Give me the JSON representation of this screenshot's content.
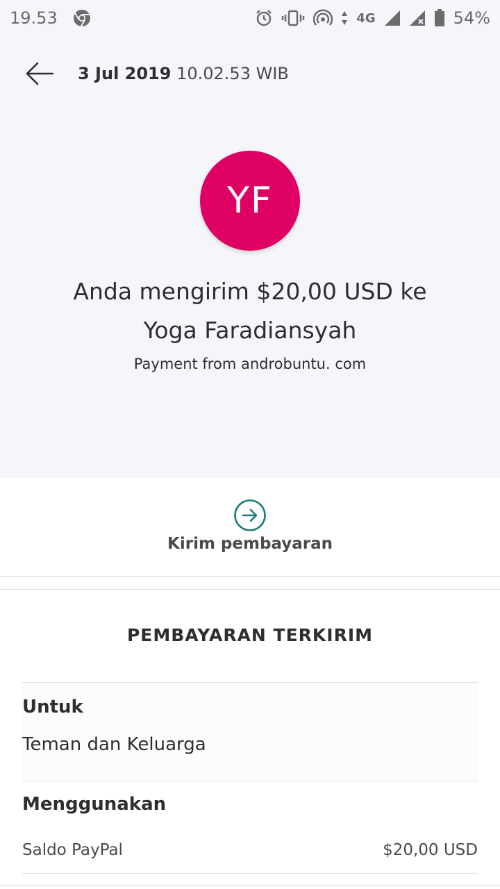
{
  "status_bar": {
    "time": "19.53",
    "network": "4G",
    "battery": "54%"
  },
  "header": {
    "date": "3 Jul 2019",
    "time": "10.02.53 WIB"
  },
  "recipient": {
    "initials": "YF",
    "avatar_color": "#de0063"
  },
  "transaction": {
    "headline_line1": "Anda mengirim $20,00 USD ke",
    "headline_line2": "Yoga Faradiansyah",
    "note": "Payment from androbuntu. com"
  },
  "action": {
    "label": "Kirim pembayaran",
    "icon": "arrow-right-circle-icon",
    "color": "#1a7d76"
  },
  "details": {
    "section_title": "PEMBAYARAN TERKIRIM",
    "for_label": "Untuk",
    "for_value": "Teman dan Keluarga",
    "using_label": "Menggunakan",
    "using_source": "Saldo PayPal",
    "using_amount": "$20,00 USD"
  }
}
